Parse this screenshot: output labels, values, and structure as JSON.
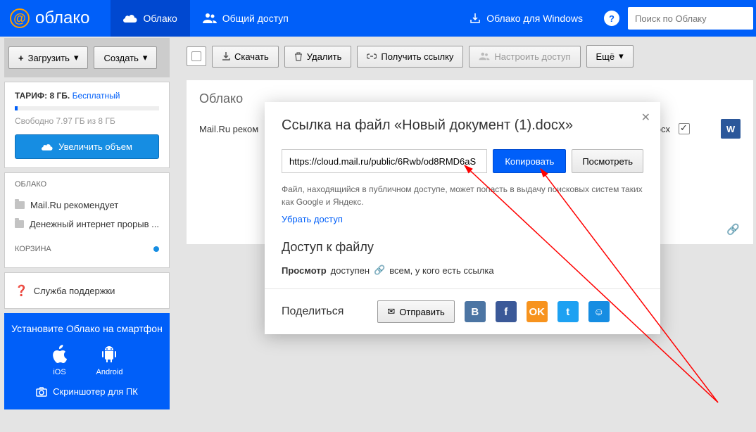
{
  "header": {
    "logo_text": "облако",
    "tab_cloud": "Облако",
    "tab_shared": "Общий доступ",
    "windows_link": "Облако для Windows",
    "search_placeholder": "Поиск по Облаку"
  },
  "sidebar": {
    "upload": "Загрузить",
    "create": "Создать",
    "tariff_label": "ТАРИФ: 8 ГБ.",
    "tariff_plan": "Бесплатный",
    "tariff_free": "Свободно 7.97 ГБ из 8 ГБ",
    "increase": "Увеличить объем",
    "cloud_h": "ОБЛАКО",
    "items": [
      {
        "label": "Mail.Ru рекомендует"
      },
      {
        "label": "Денежный интернет прорыв ..."
      }
    ],
    "trash_h": "КОРЗИНА",
    "support": "Служба поддержки",
    "promo_h": "Установите Облако на смартфон",
    "ios": "iOS",
    "android": "Android",
    "screenshoter": "Скриншотер для ПК"
  },
  "toolbar": {
    "download": "Скачать",
    "delete": "Удалить",
    "get_link": "Получить ссылку",
    "configure": "Настроить доступ",
    "more": "Ещё"
  },
  "content": {
    "breadcrumb": "Облако",
    "file1": "Mail.Ru реком",
    "file2_ext": ".docx"
  },
  "modal": {
    "title": "Ссылка на файл «Новый документ (1).docx»",
    "url": "https://cloud.mail.ru/public/6Rwb/od8RMD6aS",
    "copy": "Копировать",
    "view": "Посмотреть",
    "note": "Файл, находящийся в публичном доступе, может попасть в выдачу поисковых систем таких как Google и Яндекс.",
    "remove_link": "Убрать доступ",
    "access_h": "Доступ к файлу",
    "access_1": "Просмотр",
    "access_2": "доступен",
    "access_3": "всем, у кого есть ссылка",
    "share": "Поделиться",
    "send": "Отправить"
  }
}
